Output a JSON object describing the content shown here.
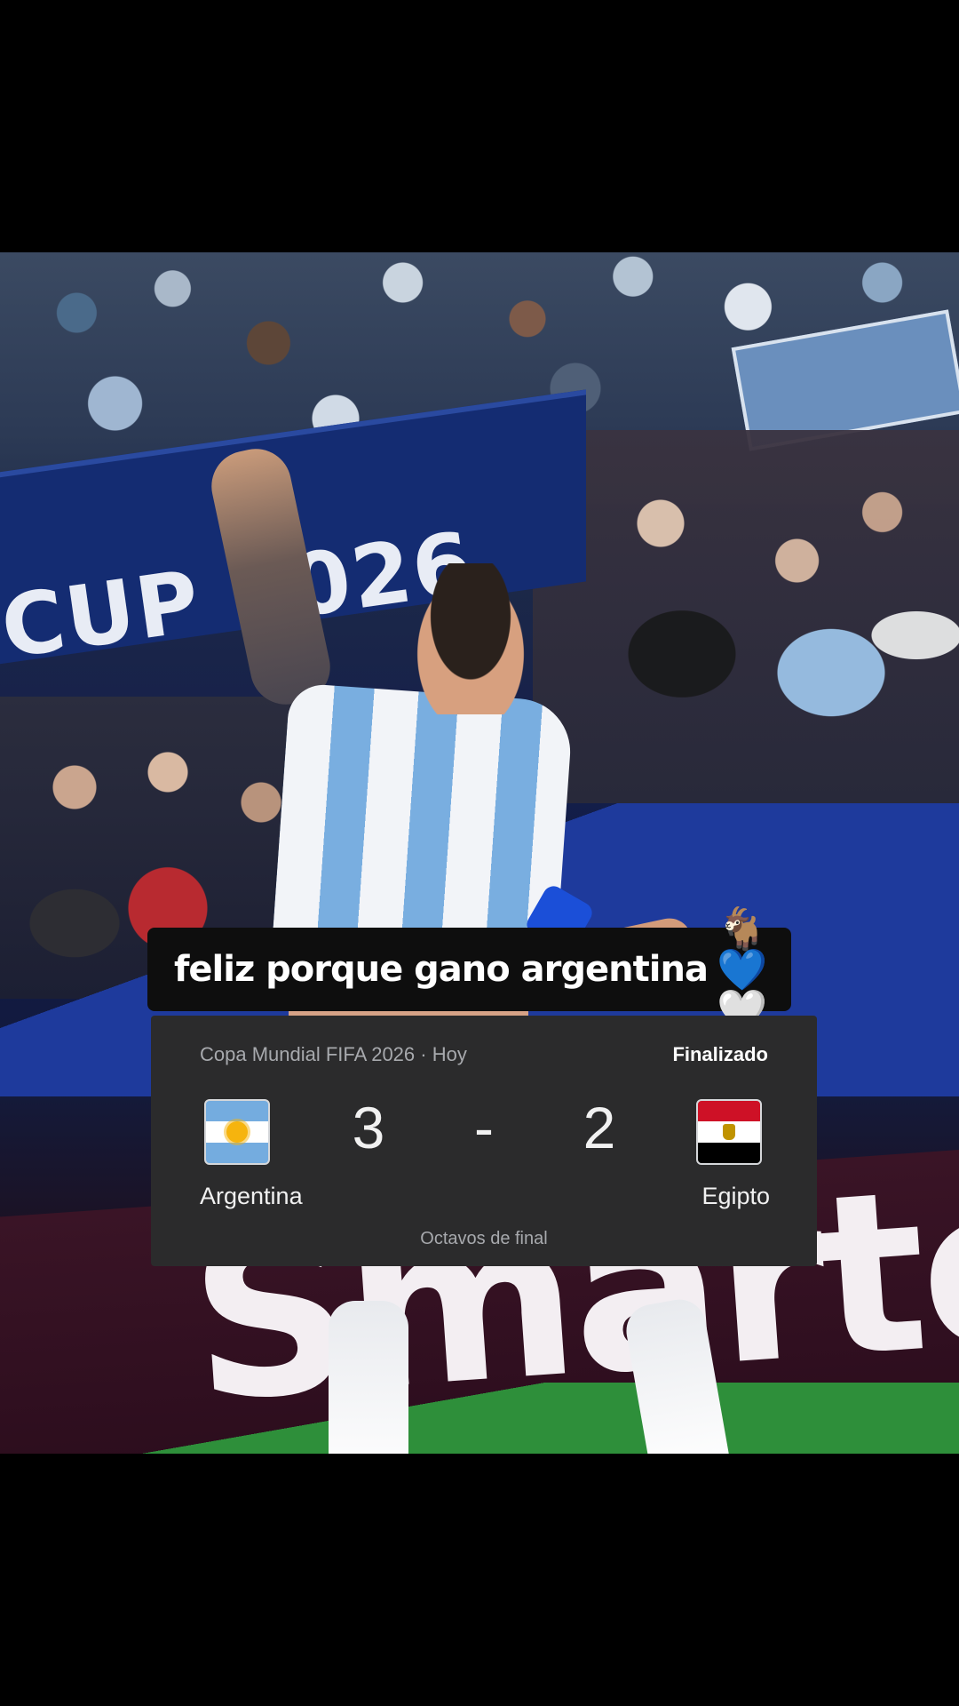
{
  "caption": {
    "text": "feliz porque gano argentina",
    "emojis": "🐐💙🤍"
  },
  "match": {
    "competition": "Copa Mundial FIFA 2026 · Hoy",
    "status": "Finalizado",
    "home_team": "Argentina",
    "away_team": "Egipto",
    "home_score": "3",
    "separator": "-",
    "away_score": "2",
    "round": "Octavos de final",
    "home_flag_icon": "argentina-flag-icon",
    "away_flag_icon": "egypt-flag-icon"
  },
  "background": {
    "banner_text": "CUP 2026",
    "ad_text": "Smarter"
  },
  "colors": {
    "card_bg": "#2b2b2c",
    "caption_bg": "#0e0e0e",
    "muted_text": "#a7a9ad"
  }
}
